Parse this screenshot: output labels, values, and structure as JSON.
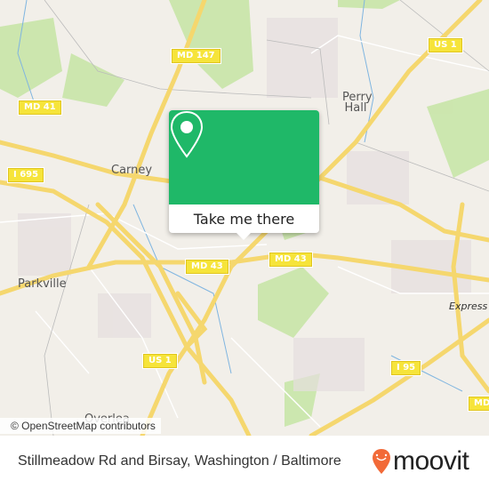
{
  "map": {
    "shields": [
      {
        "label": "MD 147"
      },
      {
        "label": "MD 41"
      },
      {
        "label": "I 695"
      },
      {
        "label": "US 1"
      },
      {
        "label": "MD 43"
      },
      {
        "label": "MD 43"
      },
      {
        "label": "US 1"
      },
      {
        "label": "I 95"
      },
      {
        "label": "MD"
      }
    ],
    "places": [
      {
        "label": "Perry Hall"
      },
      {
        "label": "Carney"
      },
      {
        "label": "Parkville"
      },
      {
        "label": "Overlea"
      },
      {
        "label": "Express"
      }
    ],
    "attribution": "© OpenStreetMap contributors"
  },
  "popup": {
    "icon": "map-pin-icon",
    "button_label": "Take me there",
    "color": "#1fb868"
  },
  "footer": {
    "title": "Stillmeadow Rd and Birsay, Washington / Baltimore",
    "brand": "moovit",
    "brand_color": "#f26a38"
  }
}
